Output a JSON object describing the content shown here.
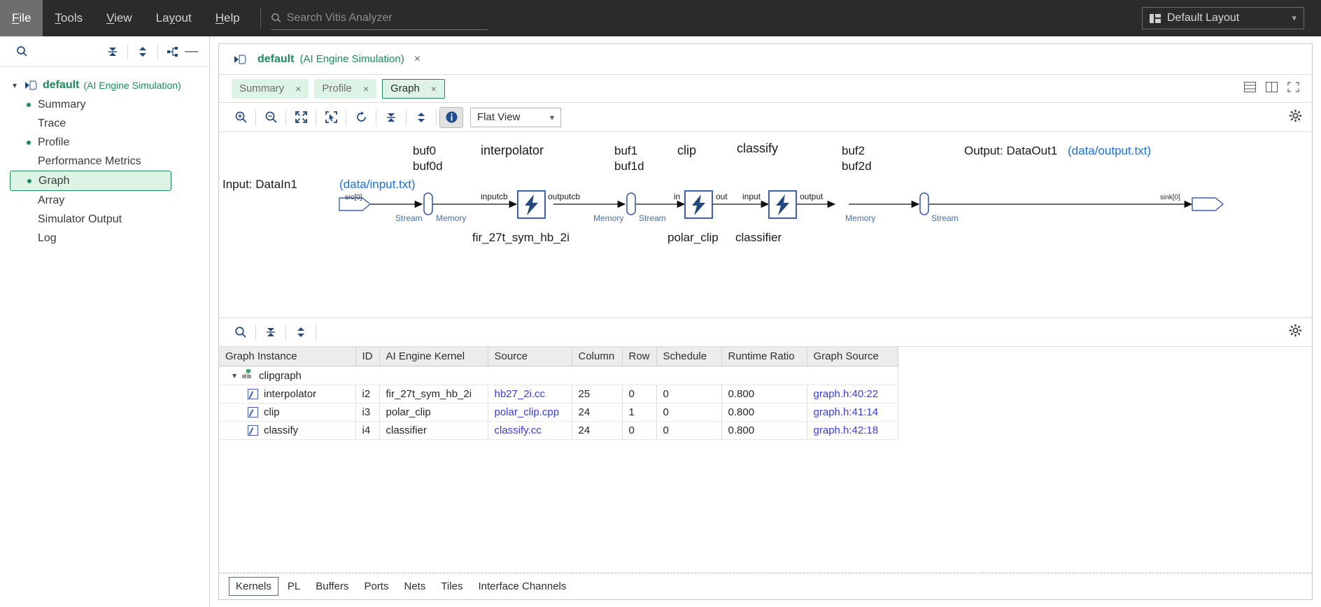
{
  "menu": {
    "items": [
      {
        "label": "File",
        "mnemonic": "F",
        "active": true
      },
      {
        "label": "Tools",
        "mnemonic": "T",
        "active": false
      },
      {
        "label": "View",
        "mnemonic": "V",
        "active": false
      },
      {
        "label": "Layout",
        "mnemonic": "y",
        "active": false
      },
      {
        "label": "Help",
        "mnemonic": "H",
        "active": false
      }
    ],
    "search_placeholder": "Search Vitis Analyzer",
    "search_value": "",
    "layout_dropdown": "Default Layout"
  },
  "sidebar": {
    "toolbar_icons": [
      "search-icon",
      "collapse-all-icon",
      "expand-all-icon",
      "link-icon",
      "minimize-icon"
    ],
    "root": {
      "label": "default",
      "sub": "(AI Engine Simulation)"
    },
    "items": [
      {
        "label": "Summary",
        "bullet": true,
        "selected": false
      },
      {
        "label": "Trace",
        "bullet": false,
        "selected": false
      },
      {
        "label": "Profile",
        "bullet": true,
        "selected": false
      },
      {
        "label": "Performance Metrics",
        "bullet": false,
        "selected": false
      },
      {
        "label": "Graph",
        "bullet": true,
        "selected": true
      },
      {
        "label": "Array",
        "bullet": false,
        "selected": false
      },
      {
        "label": "Simulator Output",
        "bullet": false,
        "selected": false
      },
      {
        "label": "Log",
        "bullet": false,
        "selected": false
      }
    ]
  },
  "panel": {
    "title": "default",
    "title_sub": "(AI Engine Simulation)",
    "close_label": "×",
    "tabs": [
      {
        "label": "Summary",
        "active": false,
        "close": "×"
      },
      {
        "label": "Profile",
        "active": false,
        "close": "×"
      },
      {
        "label": "Graph",
        "active": true,
        "close": "×"
      }
    ],
    "view_mode": "Flat View",
    "toolbar_icons": [
      "zoom-in-icon",
      "zoom-out-icon",
      "fit-screen-icon",
      "select-region-icon",
      "refresh-icon",
      "collapse-icon",
      "expand-icon",
      "info-icon"
    ]
  },
  "graph": {
    "input": {
      "label_prefix": "Input: DataIn1 ",
      "file": "(data/input.txt)",
      "port": "src[0]"
    },
    "output": {
      "label_prefix": "Output: DataOut1 ",
      "file": "(data/output.txt)",
      "port": "sink[0]"
    },
    "buffers": [
      {
        "name": "buf0",
        "name_d": "buf0d",
        "left": "Stream",
        "right": "Memory"
      },
      {
        "name": "buf1",
        "name_d": "buf1d",
        "left": "Memory",
        "right": "Stream"
      },
      {
        "name": "buf2",
        "name_d": "buf2d",
        "left": "Memory",
        "right": "Stream"
      }
    ],
    "kernels": [
      {
        "title": "interpolator",
        "subtitle": "fir_27t_sym_hb_2i",
        "in_port": "inputcb",
        "out_port": "outputcb"
      },
      {
        "title": "clip",
        "subtitle": "polar_clip",
        "in_port": "in",
        "out_port": "out"
      },
      {
        "title": "classify",
        "subtitle": "classifier",
        "in_port": "input",
        "out_port": "output"
      }
    ]
  },
  "table": {
    "toolbar_icons": [
      "search-icon",
      "collapse-all-icon",
      "expand-all-icon"
    ],
    "columns": [
      "Graph Instance",
      "ID",
      "AI Engine Kernel",
      "Source",
      "Column",
      "Row",
      "Schedule",
      "Runtime Ratio",
      "Graph Source"
    ],
    "group": {
      "label": "clipgraph",
      "expanded": true
    },
    "rows": [
      {
        "name": "interpolator",
        "id": "i2",
        "kernel": "fir_27t_sym_hb_2i",
        "source": "hb27_2i.cc",
        "column": "25",
        "row": "0",
        "schedule": "0",
        "ratio": "0.800",
        "graph_source": "graph.h:40:22"
      },
      {
        "name": "clip",
        "id": "i3",
        "kernel": "polar_clip",
        "source": "polar_clip.cpp",
        "column": "24",
        "row": "1",
        "schedule": "0",
        "ratio": "0.800",
        "graph_source": "graph.h:41:14"
      },
      {
        "name": "classify",
        "id": "i4",
        "kernel": "classifier",
        "source": "classify.cc",
        "column": "24",
        "row": "0",
        "schedule": "0",
        "ratio": "0.800",
        "graph_source": "graph.h:42:18"
      }
    ]
  },
  "bottom_tabs": [
    {
      "label": "Kernels",
      "active": true
    },
    {
      "label": "PL",
      "active": false
    },
    {
      "label": "Buffers",
      "active": false
    },
    {
      "label": "Ports",
      "active": false
    },
    {
      "label": "Nets",
      "active": false
    },
    {
      "label": "Tiles",
      "active": false
    },
    {
      "label": "Interface Channels",
      "active": false
    }
  ],
  "colors": {
    "accent_green": "#1b8a5a",
    "link_blue": "#3a3ae0",
    "node_blue": "#3f5fa8",
    "topbar_bg": "#2b2b2b"
  }
}
